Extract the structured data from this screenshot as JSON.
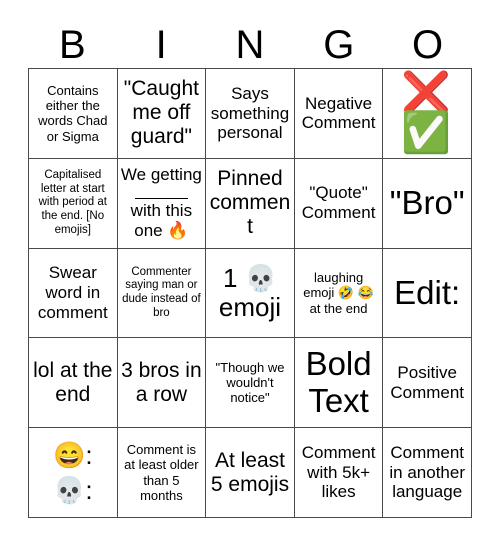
{
  "card": {
    "title_letters": [
      "B",
      "I",
      "N",
      "G",
      "O"
    ],
    "colors": {
      "background": "#ffffff",
      "grid_line": "#4a4a4a",
      "text": "#000000",
      "cross_red": "#e0402e",
      "check_green": "#79b85b"
    },
    "rows": 5,
    "columns": 5,
    "cells": [
      {
        "id": "b1",
        "text": "Contains either the words Chad or Sigma",
        "size": "fs-s"
      },
      {
        "id": "i1",
        "text": "\"Caught me off guard\"",
        "size": "fs-l"
      },
      {
        "id": "n1",
        "text": "Says something personal",
        "size": "fs-m"
      },
      {
        "id": "g1",
        "text": "Negative Comment",
        "size": "fs-m"
      },
      {
        "id": "o1",
        "text": "❌✅",
        "size": "emoji-pair",
        "icons": [
          "cross-mark-emoji",
          "check-mark-button-emoji"
        ]
      },
      {
        "id": "b2",
        "text": "Capitalised letter at start with period at the end. [No emojis]",
        "size": "fs-xs"
      },
      {
        "id": "i2",
        "text": "We getting ___ with this one 🔥",
        "size": "fs-m",
        "kind": "fill-blank",
        "line1": "We getting",
        "line2": "with this one 🔥"
      },
      {
        "id": "n2",
        "text": "Pinned comment",
        "size": "fs-l"
      },
      {
        "id": "g2",
        "text": "\"Quote\" Comment",
        "size": "fs-m"
      },
      {
        "id": "o2",
        "text": "\"Bro\"",
        "size": "fs-xxl"
      },
      {
        "id": "b3",
        "text": "Swear word in comment",
        "size": "fs-m"
      },
      {
        "id": "i3",
        "text": "Commenter saying man or dude instead of bro",
        "size": "fs-xs"
      },
      {
        "id": "n3",
        "text": "1 💀 emoji",
        "size": "fs-xl"
      },
      {
        "id": "g3",
        "text": "laughing emoji 🤣 😂 at the end",
        "size": "fs-s"
      },
      {
        "id": "o3",
        "text": "Edit:",
        "size": "fs-xxl"
      },
      {
        "id": "b4",
        "text": "lol at the end",
        "size": "fs-l"
      },
      {
        "id": "i4",
        "text": "3 bros in a row",
        "size": "fs-l"
      },
      {
        "id": "n4",
        "text": "\"Though we wouldn't notice\"",
        "size": "fs-s"
      },
      {
        "id": "g4",
        "text": "Bold Text",
        "size": "fs-xxl"
      },
      {
        "id": "o4",
        "text": "Positive Comment",
        "size": "fs-m"
      },
      {
        "id": "b5",
        "text": "😄:\n💀:",
        "size": "emoji-stack",
        "icons": [
          "grinning-face-emoji",
          "skull-emoji"
        ]
      },
      {
        "id": "i5",
        "text": "Comment is at least older than 5 months",
        "size": "fs-s"
      },
      {
        "id": "n5",
        "text": "At least 5 emojis",
        "size": "fs-l"
      },
      {
        "id": "g5",
        "text": "Comment with 5k+ likes",
        "size": "fs-m"
      },
      {
        "id": "o5",
        "text": "Comment in another language",
        "size": "fs-m"
      }
    ]
  }
}
